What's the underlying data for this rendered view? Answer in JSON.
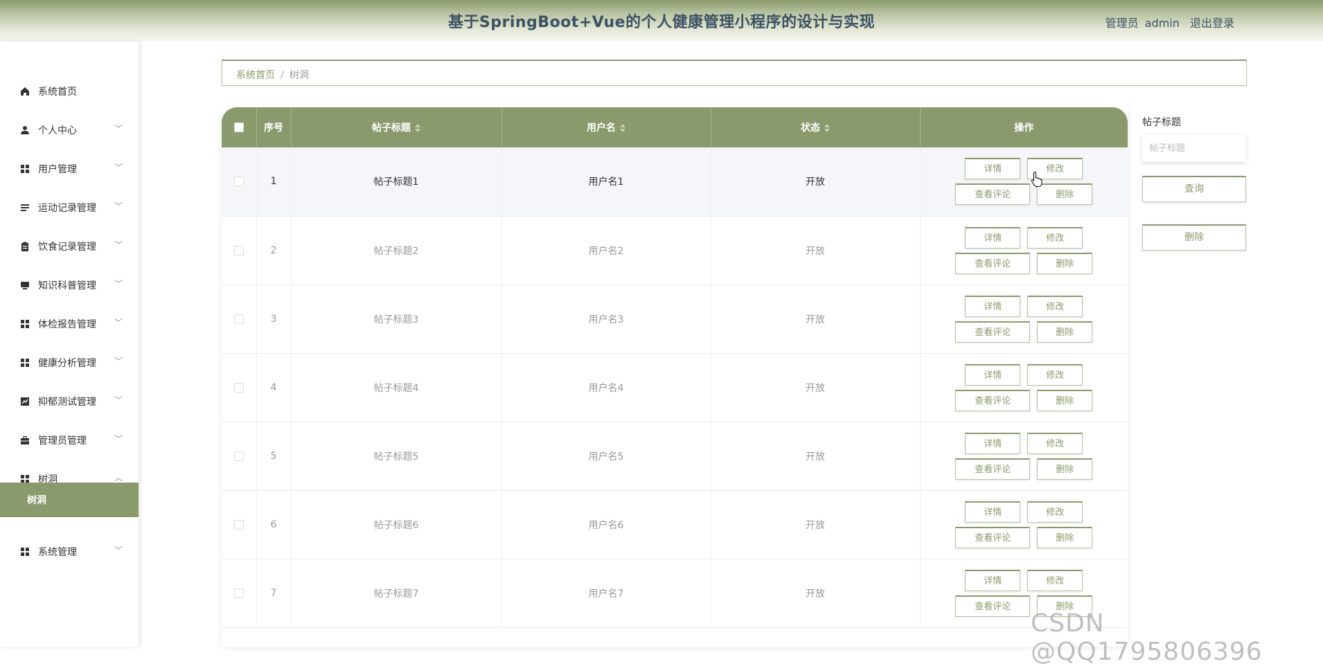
{
  "app": {
    "title": "基于SpringBoot+Vue的个人健康管理小程序的设计与实现",
    "user_role": "管理员",
    "user_name": "admin",
    "logout_label": "退出登录",
    "accent_color": "#8a9a6c"
  },
  "sidebar": {
    "items": [
      {
        "label": "系统首页",
        "icon": "home-icon",
        "expandable": false
      },
      {
        "label": "个人中心",
        "icon": "user-icon",
        "expandable": true
      },
      {
        "label": "用户管理",
        "icon": "grid-icon",
        "expandable": true
      },
      {
        "label": "运动记录管理",
        "icon": "list-icon",
        "expandable": true
      },
      {
        "label": "饮食记录管理",
        "icon": "clipboard-icon",
        "expandable": true
      },
      {
        "label": "知识科普管理",
        "icon": "monitor-icon",
        "expandable": true
      },
      {
        "label": "体检报告管理",
        "icon": "grid-icon",
        "expandable": true
      },
      {
        "label": "健康分析管理",
        "icon": "grid-icon",
        "expandable": true
      },
      {
        "label": "抑郁测试管理",
        "icon": "chart-icon",
        "expandable": true
      },
      {
        "label": "管理员管理",
        "icon": "briefcase-icon",
        "expandable": true
      },
      {
        "label": "树洞",
        "icon": "grid-icon",
        "expandable": true,
        "expanded": true
      },
      {
        "label": "系统管理",
        "icon": "grid-icon",
        "expandable": true
      }
    ],
    "active_sub": "树洞"
  },
  "breadcrumb": {
    "home": "系统首页",
    "separator": "/",
    "current": "树洞"
  },
  "table": {
    "columns": [
      "序号",
      "帖子标题",
      "用户名",
      "状态",
      "操作"
    ],
    "buttons": {
      "detail": "详情",
      "edit": "修改",
      "comments": "查看评论",
      "delete": "删除"
    },
    "rows": [
      {
        "index": "1",
        "title": "帖子标题1",
        "user": "用户名1",
        "status": "开放"
      },
      {
        "index": "2",
        "title": "帖子标题2",
        "user": "用户名2",
        "status": "开放"
      },
      {
        "index": "3",
        "title": "帖子标题3",
        "user": "用户名3",
        "status": "开放"
      },
      {
        "index": "4",
        "title": "帖子标题4",
        "user": "用户名4",
        "status": "开放"
      },
      {
        "index": "5",
        "title": "帖子标题5",
        "user": "用户名5",
        "status": "开放"
      },
      {
        "index": "6",
        "title": "帖子标题6",
        "user": "用户名6",
        "status": "开放"
      },
      {
        "index": "7",
        "title": "帖子标题7",
        "user": "用户名7",
        "status": "开放"
      }
    ]
  },
  "search": {
    "label": "帖子标题",
    "placeholder": "帖子标题",
    "query_button": "查询",
    "delete_button": "删除"
  },
  "watermark": "CSDN @QQ1795806396"
}
